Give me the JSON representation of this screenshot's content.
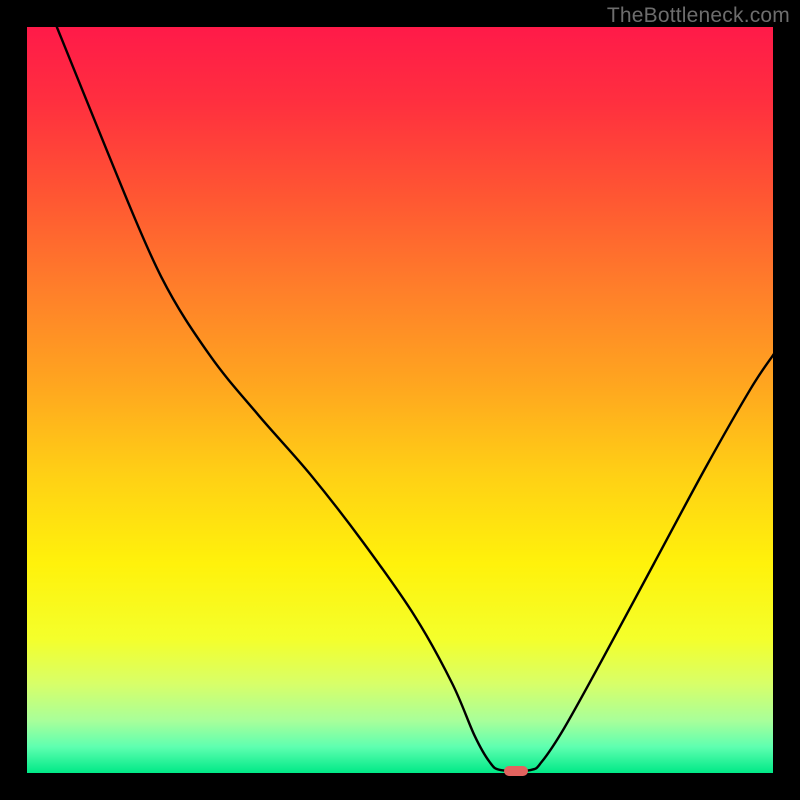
{
  "watermark": "TheBottleneck.com",
  "colors": {
    "background": "#000000",
    "watermark": "#6d6d6d",
    "curve": "#000000",
    "marker": "#e2635f"
  },
  "plot": {
    "x_range": [
      0,
      100
    ],
    "y_range": [
      0,
      100
    ]
  },
  "gradient_stops": [
    {
      "pos": 0.0,
      "color": "#ff1a49"
    },
    {
      "pos": 0.1,
      "color": "#ff2f3f"
    },
    {
      "pos": 0.22,
      "color": "#ff5433"
    },
    {
      "pos": 0.35,
      "color": "#ff7e2a"
    },
    {
      "pos": 0.48,
      "color": "#ffa61f"
    },
    {
      "pos": 0.6,
      "color": "#ffd015"
    },
    {
      "pos": 0.72,
      "color": "#fff20b"
    },
    {
      "pos": 0.82,
      "color": "#f4ff2b"
    },
    {
      "pos": 0.88,
      "color": "#d8ff68"
    },
    {
      "pos": 0.93,
      "color": "#a8ff9a"
    },
    {
      "pos": 0.965,
      "color": "#5effb0"
    },
    {
      "pos": 1.0,
      "color": "#00e987"
    }
  ],
  "chart_data": {
    "type": "line",
    "title": "",
    "xlabel": "",
    "ylabel": "",
    "xlim": [
      0,
      100
    ],
    "ylim": [
      0,
      100
    ],
    "series": [
      {
        "name": "bottleneck-curve",
        "points": [
          {
            "x": 4.0,
            "y": 100.0
          },
          {
            "x": 11.0,
            "y": 82.5
          },
          {
            "x": 18.0,
            "y": 66.5
          },
          {
            "x": 24.5,
            "y": 56.0
          },
          {
            "x": 31.0,
            "y": 48.0
          },
          {
            "x": 38.0,
            "y": 40.0
          },
          {
            "x": 45.0,
            "y": 31.0
          },
          {
            "x": 52.0,
            "y": 21.0
          },
          {
            "x": 57.0,
            "y": 12.0
          },
          {
            "x": 60.0,
            "y": 5.0
          },
          {
            "x": 62.0,
            "y": 1.5
          },
          {
            "x": 63.5,
            "y": 0.4
          },
          {
            "x": 67.5,
            "y": 0.4
          },
          {
            "x": 69.0,
            "y": 1.5
          },
          {
            "x": 72.0,
            "y": 6.0
          },
          {
            "x": 77.0,
            "y": 15.0
          },
          {
            "x": 84.0,
            "y": 28.0
          },
          {
            "x": 91.0,
            "y": 41.0
          },
          {
            "x": 97.0,
            "y": 51.5
          },
          {
            "x": 100.0,
            "y": 56.0
          }
        ]
      }
    ],
    "marker": {
      "x": 65.5,
      "y": 0.3,
      "width_pct": 3.2,
      "height_pct": 1.3
    }
  }
}
